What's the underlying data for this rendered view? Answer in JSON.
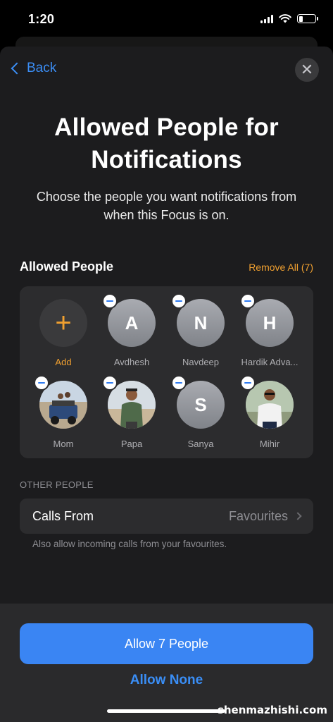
{
  "status_bar": {
    "time": "1:20"
  },
  "nav": {
    "back_label": "Back",
    "close_glyph": "✕"
  },
  "header": {
    "title_line1": "Allowed People for",
    "title_line2": "Notifications",
    "subtitle": "Choose the people you want notifications from when this Focus is on."
  },
  "allowed_people": {
    "section_title": "Allowed People",
    "remove_all_label": "Remove All (7)",
    "add_label": "Add",
    "add_glyph": "+",
    "people": [
      {
        "name": "Avdhesh",
        "initial": "A",
        "type": "initial"
      },
      {
        "name": "Navdeep",
        "initial": "N",
        "type": "initial"
      },
      {
        "name": "Hardik Adva...",
        "initial": "H",
        "type": "initial"
      },
      {
        "name": "Mom",
        "type": "photo"
      },
      {
        "name": "Papa",
        "type": "photo"
      },
      {
        "name": "Sanya",
        "initial": "S",
        "type": "initial"
      },
      {
        "name": "Mihir",
        "type": "photo"
      }
    ]
  },
  "other_people": {
    "section_label": "OTHER PEOPLE",
    "calls_from_label": "Calls From",
    "calls_from_value": "Favourites",
    "footer": "Also allow incoming calls from your favourites."
  },
  "actions": {
    "allow_button": "Allow 7 People",
    "allow_none": "Allow None"
  },
  "watermark": "shenmazhishi.com",
  "colors": {
    "accent_blue": "#3a85f3",
    "accent_orange": "#f0a030",
    "background": "#1c1c1e",
    "card": "#2c2c2e"
  }
}
